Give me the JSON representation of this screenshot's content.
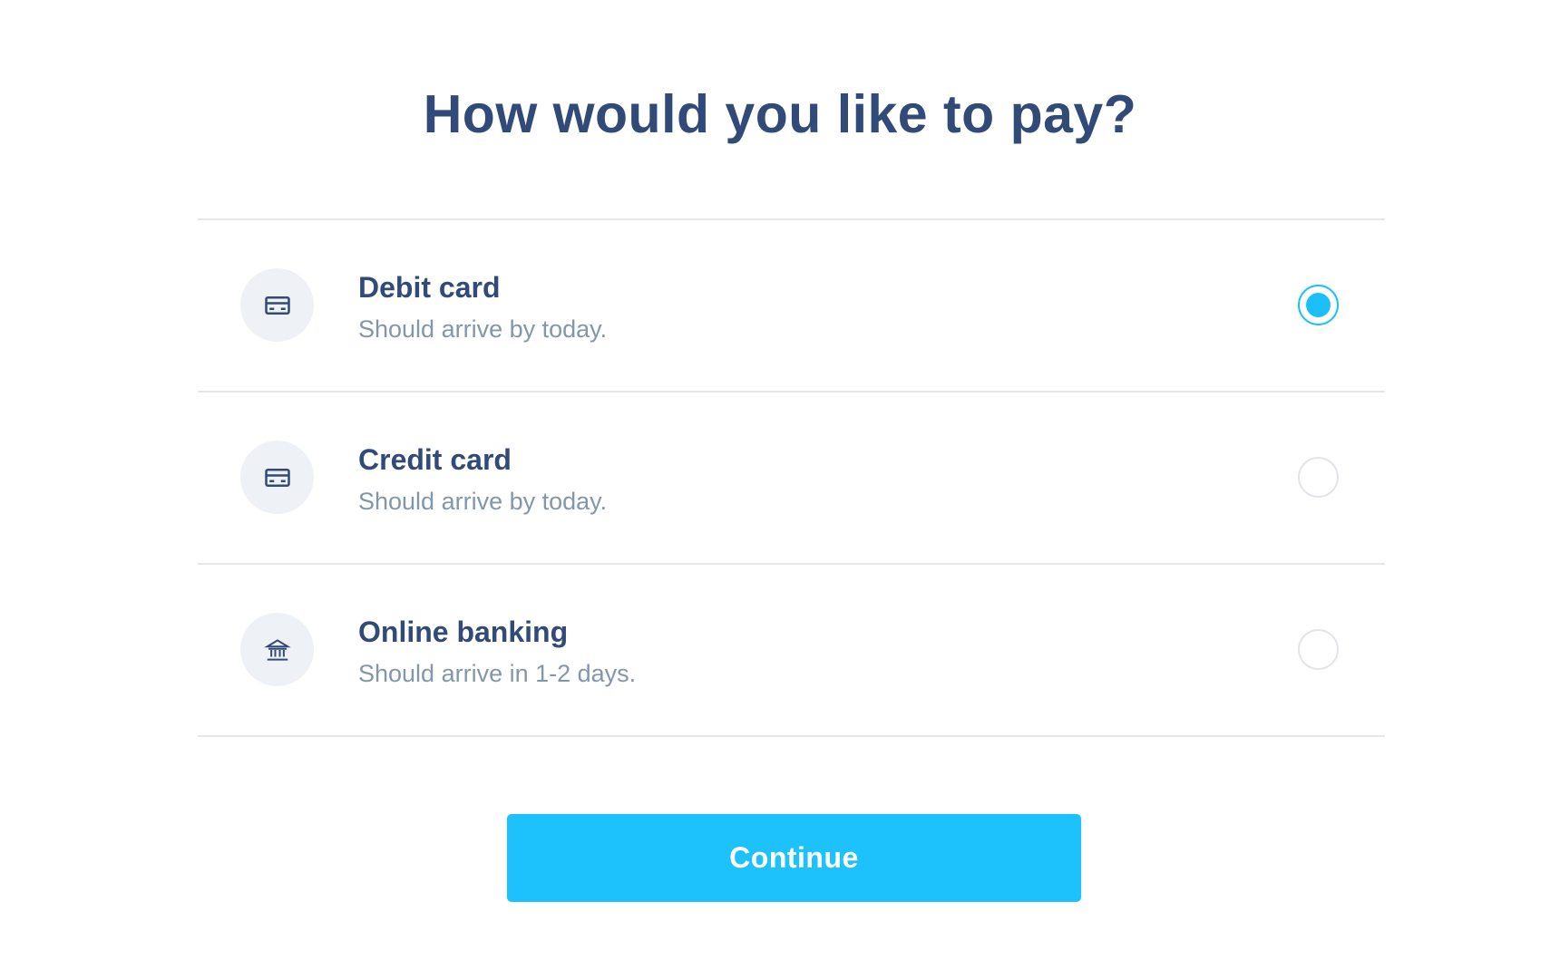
{
  "title": "How would you like to pay?",
  "options": [
    {
      "title": "Debit card",
      "subtitle": "Should arrive by today.",
      "icon": "credit-card-icon",
      "selected": true
    },
    {
      "title": "Credit card",
      "subtitle": "Should arrive by today.",
      "icon": "credit-card-icon",
      "selected": false
    },
    {
      "title": "Online banking",
      "subtitle": "Should arrive in 1-2 days.",
      "icon": "bank-icon",
      "selected": false
    }
  ],
  "continue_label": "Continue",
  "colors": {
    "heading": "#324a78",
    "subtext": "#8397a9",
    "accent": "#1dc2fd",
    "icon_bg": "#eef1f5",
    "divider": "#e4e7eb"
  }
}
